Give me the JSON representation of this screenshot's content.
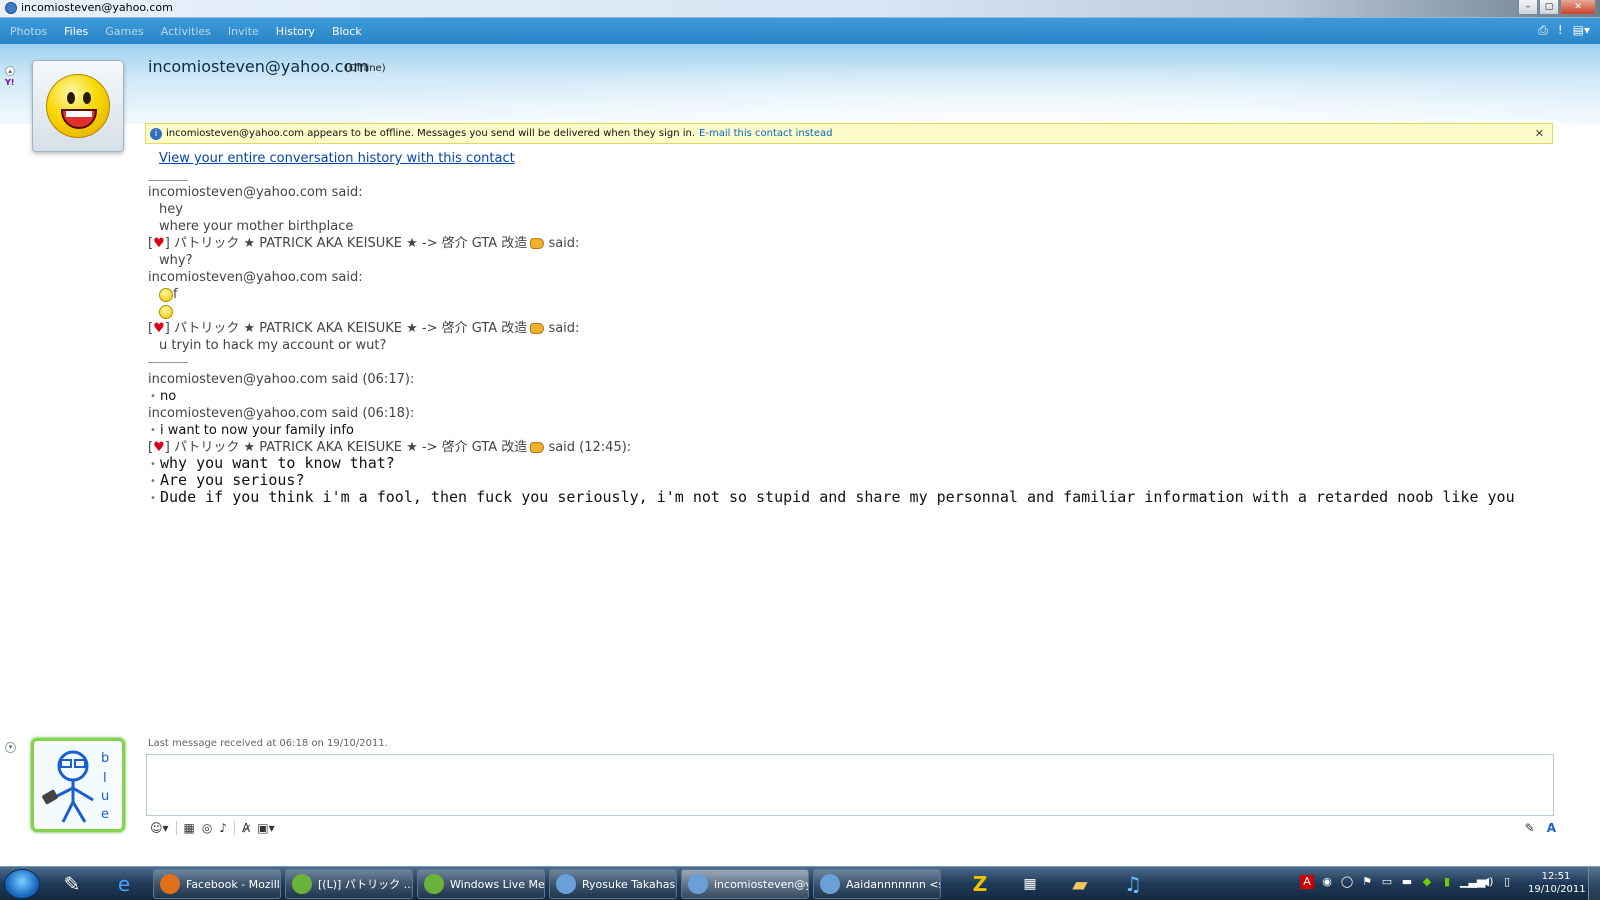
{
  "window": {
    "title": "incomiosteven@yahoo.com"
  },
  "menu": {
    "items": [
      {
        "label": "Photos",
        "active": false
      },
      {
        "label": "Files",
        "active": true
      },
      {
        "label": "Games",
        "active": false
      },
      {
        "label": "Activities",
        "active": false
      },
      {
        "label": "Invite",
        "active": false
      },
      {
        "label": "History",
        "active": true
      },
      {
        "label": "Block",
        "active": true
      }
    ],
    "icons": [
      "printer-icon",
      "alert-icon",
      "options-icon"
    ]
  },
  "contact": {
    "name": "incomiosteven@yahoo.com",
    "status": "(Offline)"
  },
  "infobar": {
    "text": "incomiosteven@yahoo.com appears to be offline. Messages you send will be delivered when they sign in.",
    "link": "E-mail this contact instead"
  },
  "history_link": "View your entire conversation history with this contact",
  "conversation": {
    "s1": "incomiosteven@yahoo.com said:",
    "m1a": "hey",
    "m1b": "where your mother birthplace",
    "p1_name": "] パトリック ★ PATRICK AKA KEISUKE ★ -> 啓介 GTA 改造",
    "p1_said": " said:",
    "m2": "why?",
    "s3": "incomiosteven@yahoo.com said:",
    "m3a": "f",
    "p4_name": "] パトリック ★ PATRICK AKA KEISUKE ★ -> 啓介 GTA 改造",
    "p4_said": " said:",
    "m4": "u tryin to hack my account or wut?",
    "s5": "incomiosteven@yahoo.com said (06:17):",
    "m5": "no",
    "s6": "incomiosteven@yahoo.com said (06:18):",
    "m6": "i want to now your family info",
    "p7_name": "] パトリック ★ PATRICK AKA KEISUKE ★ -> 啓介 GTA 改造",
    "p7_said": " said (12:45):",
    "m7a": "why you want to know that?",
    "m7b": "Are you serious?",
    "m7c": "Dude if you think i'm a fool, then fuck you seriously, i'm not so stupid and share my personnal and familiar information with a retarded noob like you"
  },
  "last_message": "Last message received at 06:18 on 19/10/2011.",
  "taskbar": {
    "tasks": [
      {
        "label": "Facebook - Mozill...",
        "color": "#e0701a"
      },
      {
        "label": "[(L)] パトリック ...",
        "color": "#6bb23a"
      },
      {
        "label": "Windows Live Me...",
        "color": "#6bb23a"
      },
      {
        "label": "Ryosuke Takahas...",
        "color": "#6aa0d8"
      },
      {
        "label": "incomiosteven@y...",
        "color": "#6aa0d8"
      },
      {
        "label": "Aaidannnnnnn <s...",
        "color": "#6aa0d8"
      }
    ],
    "clock_time": "12:51",
    "clock_date": "19/10/2011"
  }
}
